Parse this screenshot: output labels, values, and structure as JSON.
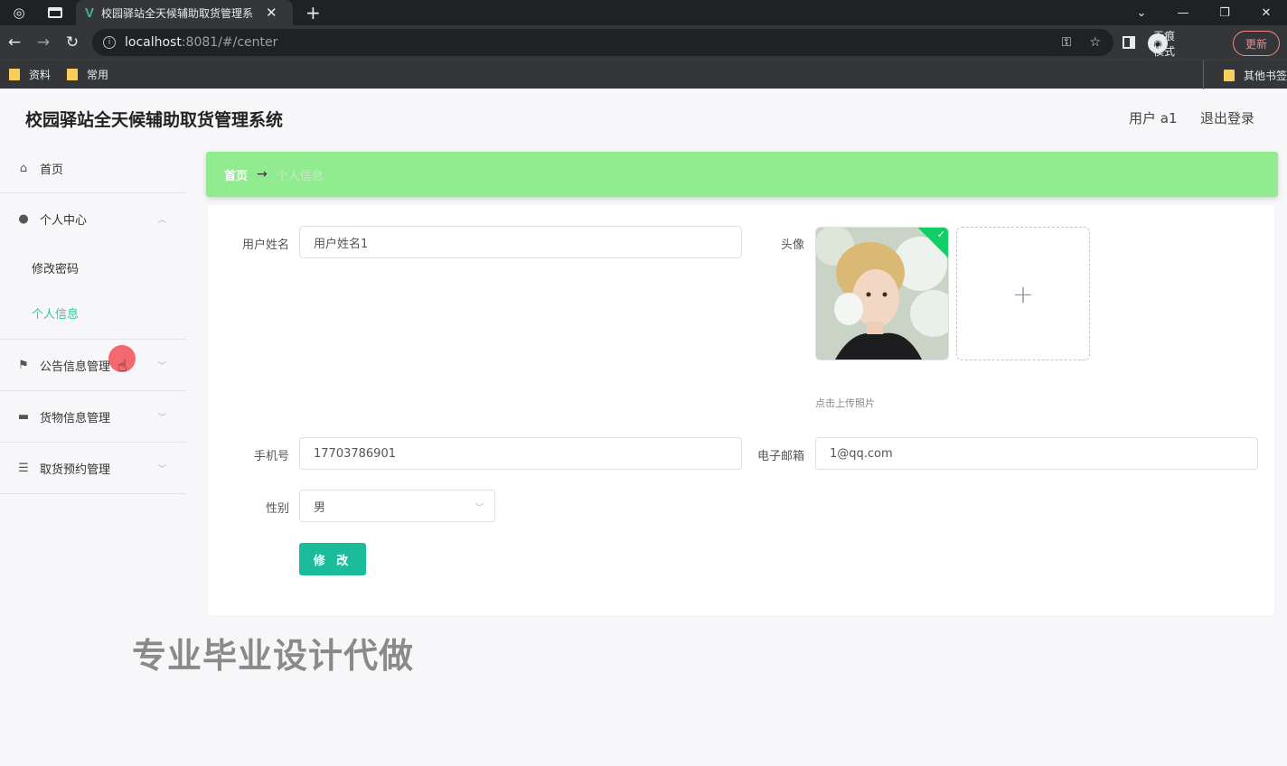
{
  "browser": {
    "tab_title": "校园驿站全天候辅助取货管理系",
    "url_host": "localhost",
    "url_path": ":8081/#/center",
    "incognito_label": "无痕模式",
    "update_label": "更新",
    "bookmarks": [
      "资料",
      "常用"
    ],
    "other_bookmarks": "其他书签"
  },
  "header": {
    "title": "校园驿站全天候辅助取货管理系统",
    "user": "用户 a1",
    "logout": "退出登录"
  },
  "sidebar": {
    "home": "首页",
    "personal_center": "个人中心",
    "change_password": "修改密码",
    "personal_info": "个人信息",
    "notice_mgmt": "公告信息管理",
    "goods_mgmt": "货物信息管理",
    "pickup_mgmt": "取货预约管理"
  },
  "breadcrumb": {
    "home": "首页",
    "arrow": "→",
    "current": "个人信息"
  },
  "form": {
    "username_label": "用户姓名",
    "username_value": "用户姓名1",
    "avatar_label": "头像",
    "upload_hint": "点击上传照片",
    "phone_label": "手机号",
    "phone_value": "17703786901",
    "email_label": "电子邮箱",
    "email_value": "1@qq.com",
    "gender_label": "性别",
    "gender_value": "男",
    "submit_label": "修 改"
  },
  "watermark": "专业毕业设计代做",
  "colors": {
    "breadcrumb_bg": "#90ec8e",
    "accent": "#1abc9c",
    "active_menu": "#33c5a2"
  }
}
